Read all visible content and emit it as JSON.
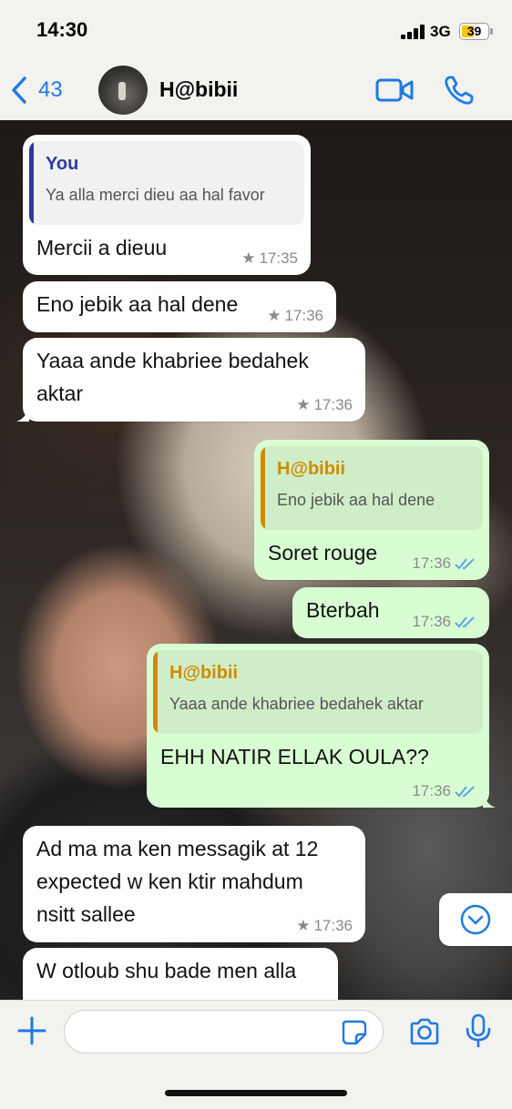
{
  "status_bar": {
    "time": "14:30",
    "network": "3G",
    "battery": "39"
  },
  "header": {
    "back_count": "43",
    "contact_name": "H@bibii",
    "icons": {
      "back": "chevron-left-icon",
      "video": "video-camera-icon",
      "phone": "phone-icon"
    }
  },
  "colors": {
    "accent": "#1f7ae0",
    "outgoing_bubble": "#d9fdd3",
    "incoming_bubble": "#ffffff",
    "quote_you": "#2d3aa0",
    "quote_contact": "#d08b00",
    "read_receipt": "#4a9fea",
    "battery_fill": "#f6c515"
  },
  "messages": [
    {
      "direction": "in",
      "quote": {
        "author": "You",
        "text": "Ya alla merci dieu aa hal favor"
      },
      "text": "Mercii a dieuu",
      "time": "17:35",
      "starred": true
    },
    {
      "direction": "in",
      "text": "Eno jebik aa hal dene",
      "time": "17:36",
      "starred": true
    },
    {
      "direction": "in",
      "text_lines": [
        "Yaaa ande khabriee bedahek",
        "aktar"
      ],
      "time": "17:36",
      "starred": true
    },
    {
      "direction": "out",
      "quote": {
        "author": "H@bibii",
        "text": "Eno jebik aa hal dene"
      },
      "text": "Soret rouge",
      "time": "17:36",
      "status": "read"
    },
    {
      "direction": "out",
      "text": "Bterbah",
      "time": "17:36",
      "status": "read"
    },
    {
      "direction": "out",
      "quote": {
        "author": "H@bibii",
        "text": "Yaaa ande khabriee bedahek aktar"
      },
      "text": "EHH NATIR ELLAK OULA??",
      "time": "17:36",
      "status": "read"
    },
    {
      "direction": "in",
      "text_lines": [
        "Ad ma ma ken messagik at 12",
        "expected w ken ktir mahdum",
        "nsitt sallee"
      ],
      "time": "17:36",
      "starred": true
    },
    {
      "direction": "in",
      "text": "W otloub shu bade men alla"
    }
  ],
  "composer": {
    "input_value": "",
    "icons": {
      "add": "plus-icon",
      "sticker": "sticker-icon",
      "camera": "camera-icon",
      "mic": "microphone-icon"
    }
  },
  "scroll_button_icon": "chevron-down-icon"
}
